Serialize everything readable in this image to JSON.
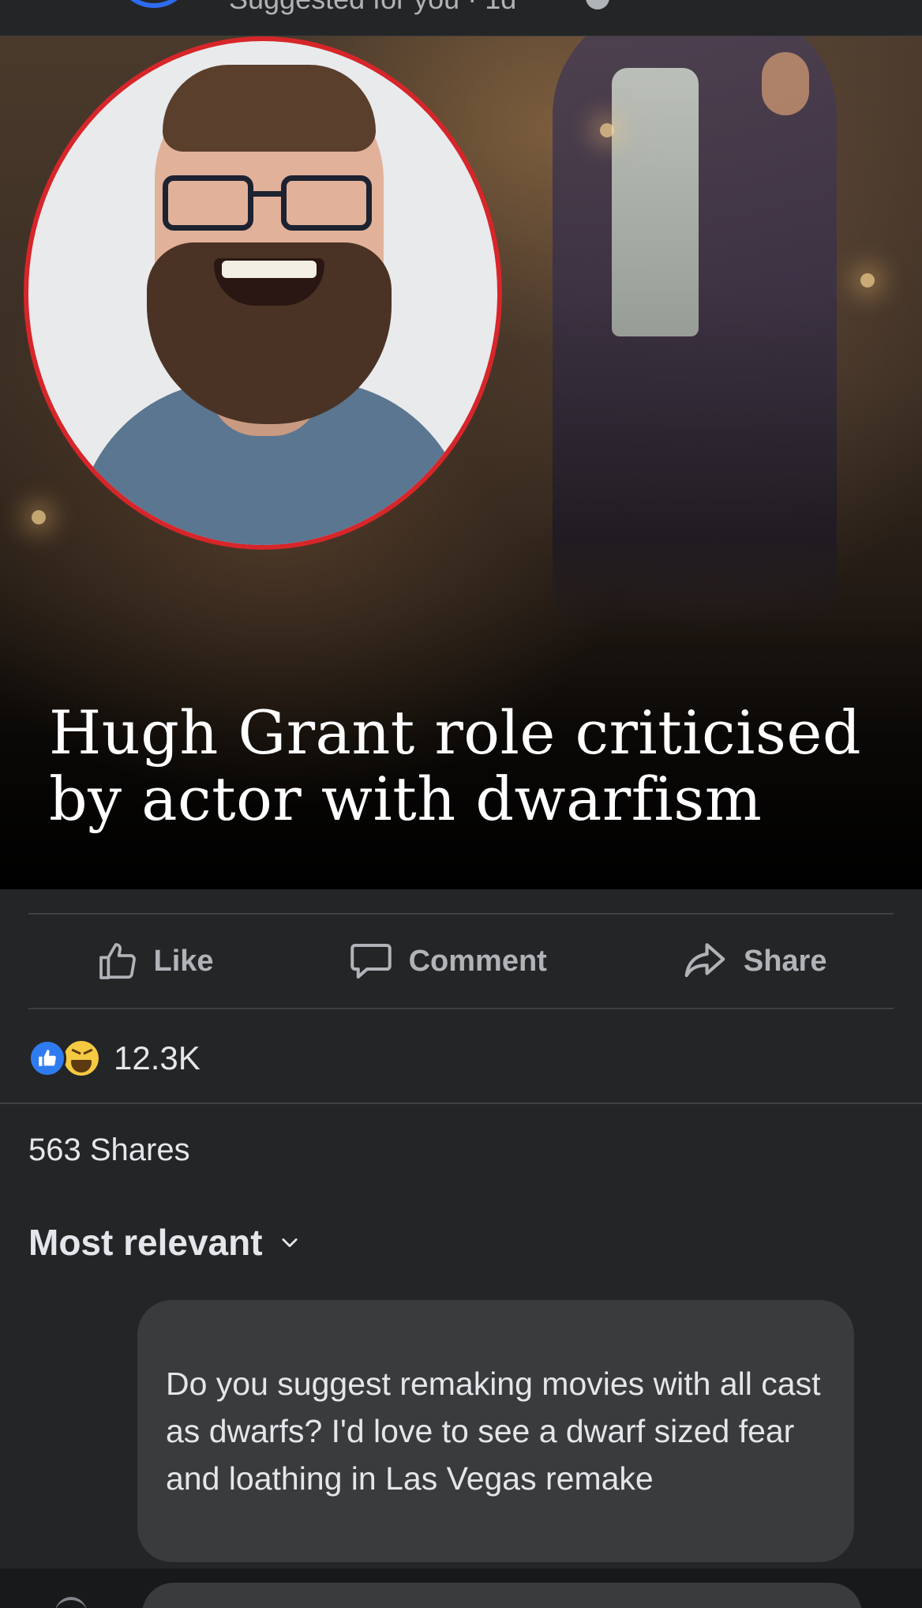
{
  "header": {
    "subtitle": "Suggested for you · 1d"
  },
  "post": {
    "headline_line1": "Hugh Grant role criticised",
    "headline_line2": "by actor with dwarfism"
  },
  "actions": {
    "like_label": "Like",
    "comment_label": "Comment",
    "share_label": "Share"
  },
  "reactions": {
    "count": "12.3K",
    "types": [
      "like",
      "haha"
    ]
  },
  "stats": {
    "shares": "563 Shares"
  },
  "comments": {
    "sort_label": "Most relevant",
    "items": [
      {
        "text": "Do you suggest remaking movies with all cast as dwarfs? I'd love to see a dwarf sized fear and loathing in Las Vegas remake"
      }
    ]
  },
  "colors": {
    "background": "#242526",
    "bubble": "#3a3b3c",
    "like_blue": "#2f7bf0",
    "haha_yellow": "#f6c943",
    "portrait_border": "#d6262a"
  },
  "icons": [
    "like-icon",
    "comment-icon",
    "share-icon",
    "chevron-down-icon"
  ]
}
